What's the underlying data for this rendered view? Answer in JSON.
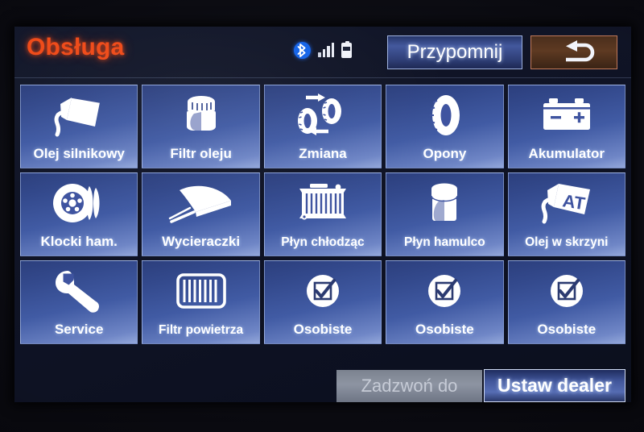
{
  "header": {
    "title": "Obsługa",
    "status_icons": [
      "bluetooth-icon",
      "signal-bars-icon",
      "battery-icon"
    ],
    "remind_label": "Przypomnij",
    "back_icon": "back-arrow-icon",
    "title_color": "#f04a18"
  },
  "tiles": [
    {
      "label": "Olej silnikowy",
      "icon": "oil-can-icon"
    },
    {
      "label": "Filtr oleju",
      "icon": "oil-filter-icon"
    },
    {
      "label": "Zmiana",
      "icon": "tire-rotation-icon"
    },
    {
      "label": "Opony",
      "icon": "tire-icon"
    },
    {
      "label": "Akumulator",
      "icon": "car-battery-icon"
    },
    {
      "label": "Klocki ham.",
      "icon": "brake-pads-icon"
    },
    {
      "label": "Wycieraczki",
      "icon": "wiper-blade-icon"
    },
    {
      "label": "Płyn chłodząc",
      "icon": "radiator-icon"
    },
    {
      "label": "Płyn hamulco",
      "icon": "brake-fluid-reservoir-icon"
    },
    {
      "label": "Olej w skrzyni",
      "icon": "transmission-oil-at-icon"
    },
    {
      "label": "Service",
      "icon": "wrench-icon"
    },
    {
      "label": "Filtr powietrza",
      "icon": "air-filter-icon"
    },
    {
      "label": "Osobiste",
      "icon": "checkbox-checked-icon"
    },
    {
      "label": "Osobiste",
      "icon": "checkbox-checked-icon"
    },
    {
      "label": "Osobiste",
      "icon": "checkbox-checked-icon"
    }
  ],
  "footer": {
    "call_dealer_label": "Zadzwoń do",
    "call_dealer_disabled": true,
    "set_dealer_label": "Ustaw dealer"
  },
  "colors": {
    "title_orange": "#f04a18",
    "tile_blue_dark": "#2c3f7d",
    "tile_blue_light": "#93a7da",
    "disabled_grey": "#8d94a2",
    "screen_background": "#101426"
  }
}
